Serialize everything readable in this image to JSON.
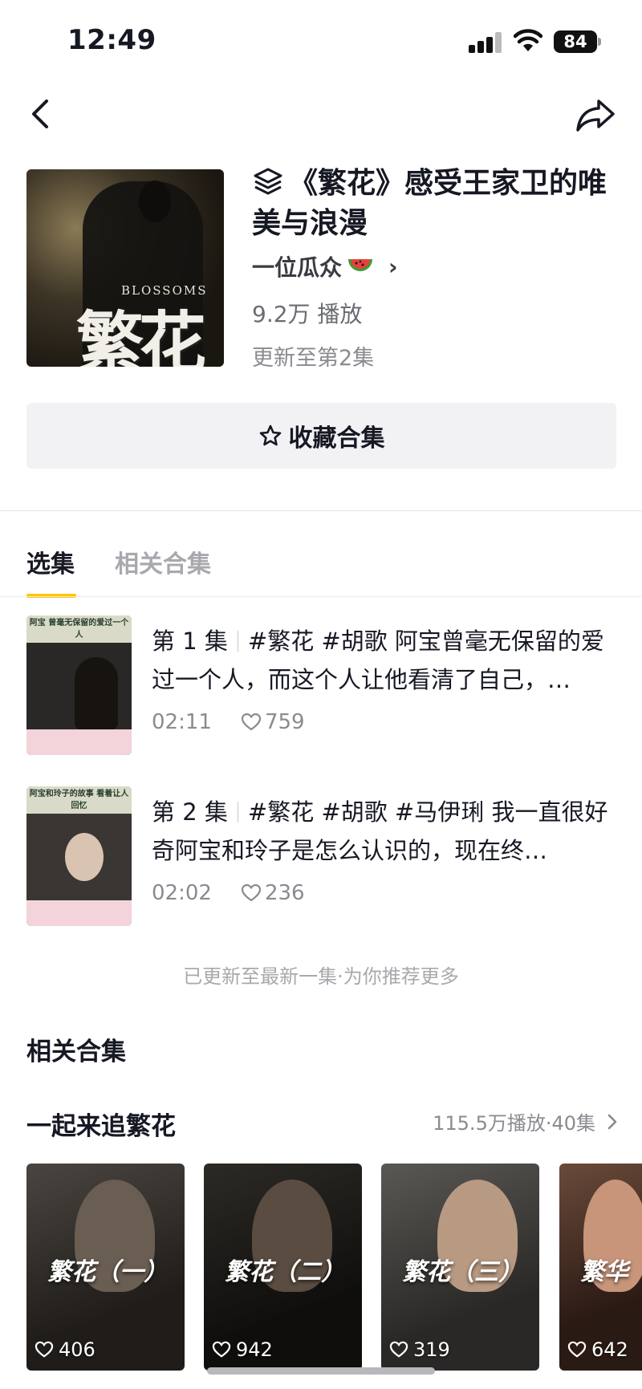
{
  "status_bar": {
    "time": "12:49",
    "battery": "84"
  },
  "collection": {
    "title": "《繁花》感受王家卫的唯美与浪漫",
    "author": "一位瓜众",
    "plays": "9.2万 播放",
    "updated": "更新至第2集",
    "cover_subtitle": "BLOSSOMS",
    "cover_title": "繁花",
    "collect_label": "收藏合集"
  },
  "tabs": [
    {
      "label": "选集",
      "active": true
    },
    {
      "label": "相关合集",
      "active": false
    }
  ],
  "episodes": [
    {
      "num": "第 1 集",
      "text": "#繁花 #胡歌 阿宝曾毫无保留的爱过一个人，而这个人让他看清了自己，…",
      "duration": "02:11",
      "likes": "759",
      "thumb_caption": "阿宝 曾毫无保留的爱过一个人"
    },
    {
      "num": "第 2 集",
      "text": "#繁花 #胡歌 #马伊琍 我一直很好奇阿宝和玲子是怎么认识的，现在终…",
      "duration": "02:02",
      "likes": "236",
      "thumb_caption": "阿宝和玲子的故事 看着让人回忆"
    }
  ],
  "more_note": "已更新至最新一集·为你推荐更多",
  "related": {
    "heading": "相关合集",
    "series_title": "一起来追繁花",
    "series_meta": "115.5万播放·40集",
    "cards": [
      {
        "label": "繁花（一）",
        "likes": "406"
      },
      {
        "label": "繁花（二）",
        "likes": "942"
      },
      {
        "label": "繁花（三）",
        "likes": "319"
      },
      {
        "label": "繁华",
        "likes": "642"
      }
    ]
  },
  "colors": {
    "accent": "#ffc300",
    "text": "#161823",
    "muted": "#8a8b91"
  }
}
